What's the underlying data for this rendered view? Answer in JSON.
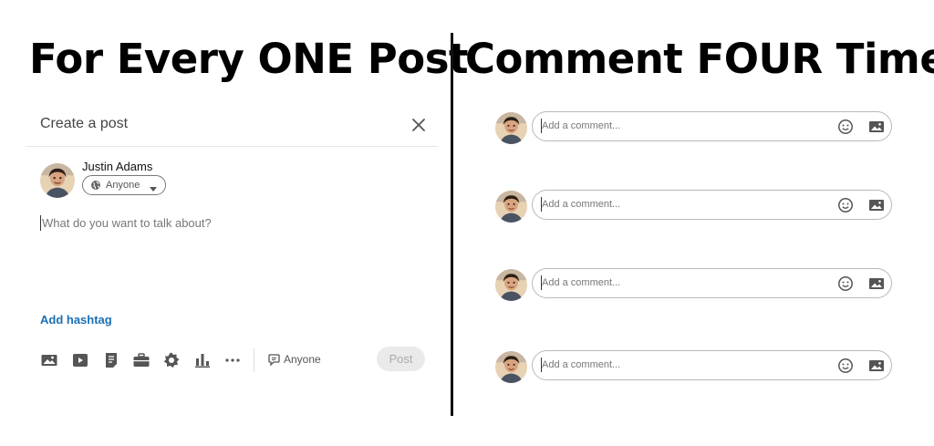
{
  "headlines": {
    "left": "For Every ONE Post",
    "right": "Comment FOUR Times"
  },
  "create_post": {
    "title": "Create a post",
    "author_name": "Justin Adams",
    "visibility": "Anyone",
    "composer_placeholder": "What do you want to talk about?",
    "hashtag_link": "Add hashtag",
    "toolbar_icons": [
      "photo-icon",
      "video-icon",
      "document-icon",
      "job-icon",
      "celebrate-icon",
      "poll-icon",
      "more-icon"
    ],
    "comment_visibility": "Anyone",
    "post_button": "Post"
  },
  "comments": [
    {
      "placeholder": "Add a comment..."
    },
    {
      "placeholder": "Add a comment..."
    },
    {
      "placeholder": "Add a comment..."
    },
    {
      "placeholder": "Add a comment..."
    }
  ],
  "colors": {
    "link": "#1a6fb5",
    "divider": "#111111",
    "post_button_bg": "#eaeaea"
  }
}
